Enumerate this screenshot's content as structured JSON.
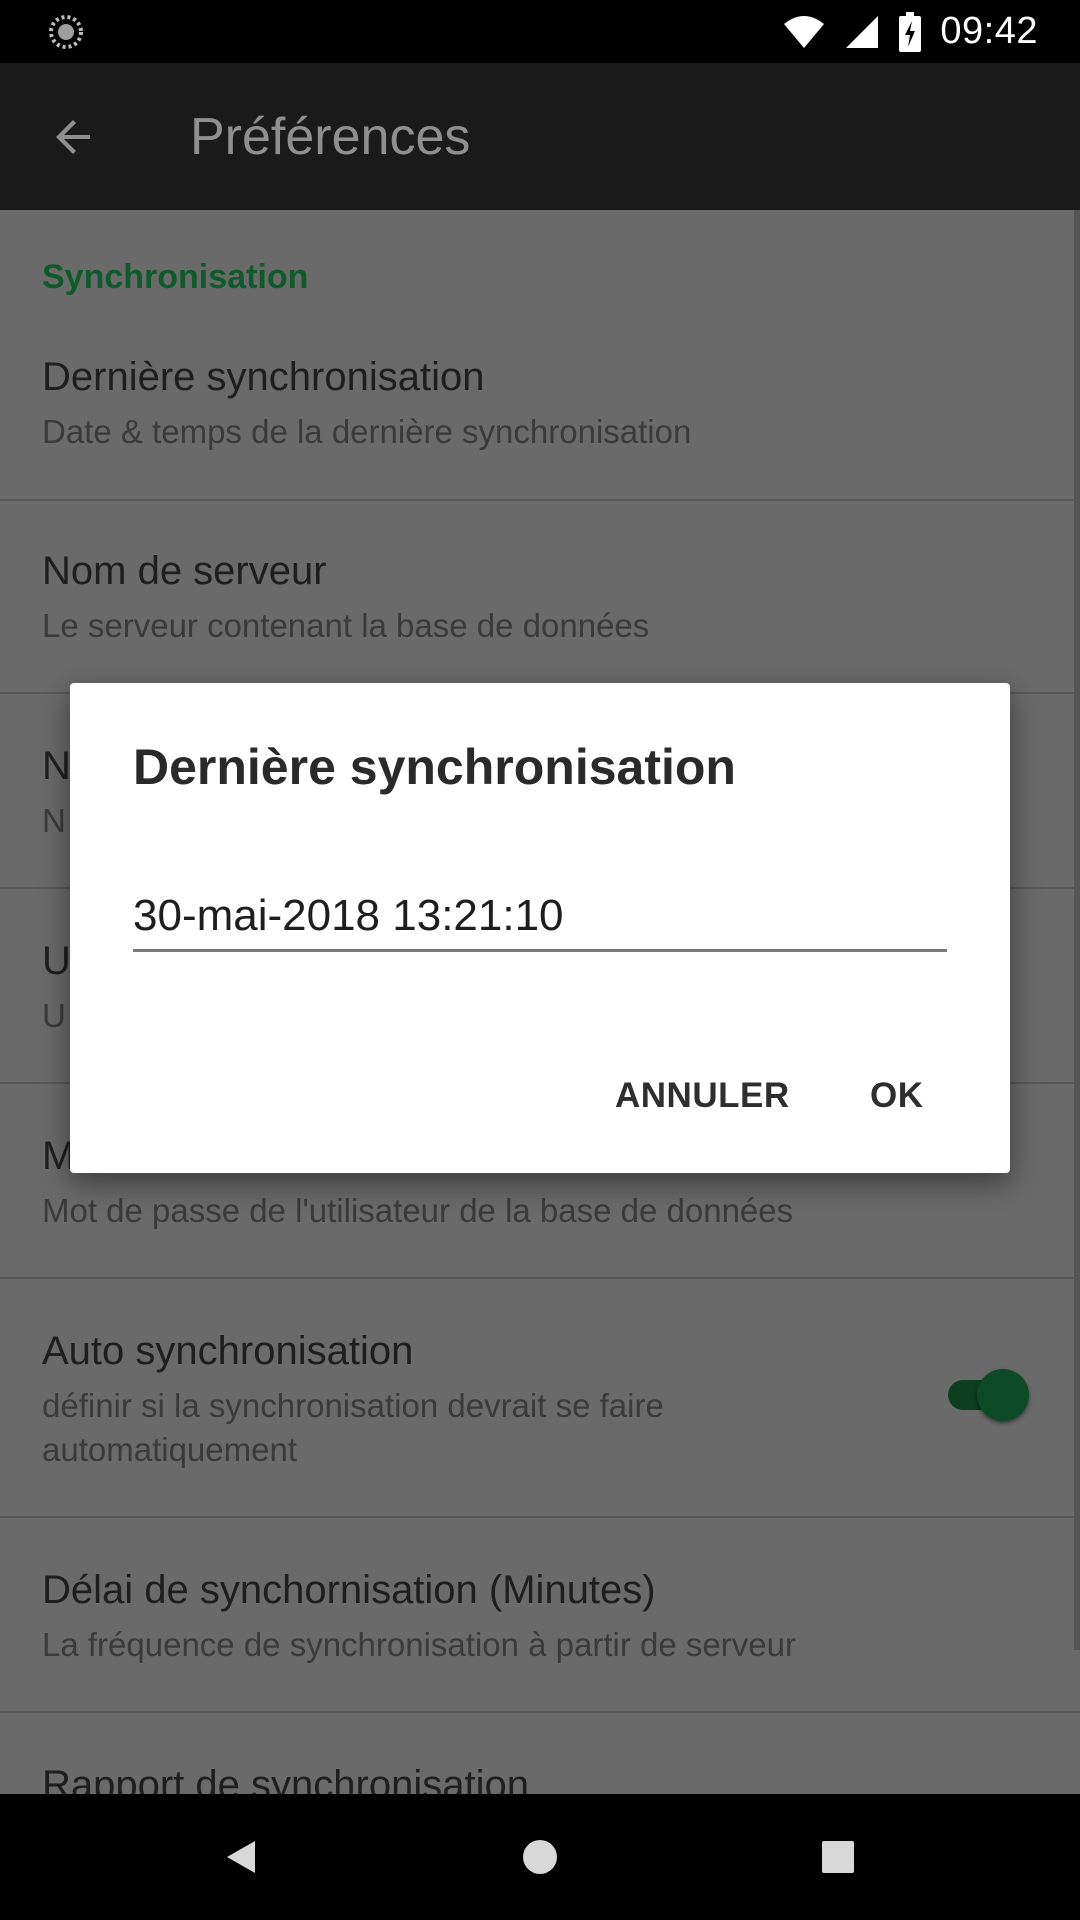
{
  "status_bar": {
    "time": "09:42",
    "icons": [
      "loading-spinner-icon",
      "wifi-icon",
      "signal-icon",
      "battery-charging-icon"
    ]
  },
  "app_bar": {
    "back_icon": "arrow-back-icon",
    "title": "Préférences"
  },
  "preferences": {
    "section_header": "Synchronisation",
    "items": [
      {
        "title": "Dernière synchronisation",
        "summary": "Date & temps de la dernière synchronisation"
      },
      {
        "title": "Nom de serveur",
        "summary": "Le serveur contenant la base de données"
      },
      {
        "title": "N",
        "summary": "N"
      },
      {
        "title": "U",
        "summary": "U"
      },
      {
        "title": "M",
        "summary": "Mot de passe de l'utilisateur de la base de données"
      },
      {
        "title": "Auto synchronisation",
        "summary_line1": "définir si la synchronisation devrait se faire",
        "summary_line2": "automatiquement",
        "toggle_on": true
      },
      {
        "title": "Délai de synchornisation (Minutes)",
        "summary": "La fréquence de synchronisation à partir de serveur"
      },
      {
        "title": "Rapport de synchronisation"
      }
    ]
  },
  "dialog": {
    "title": "Dernière synchronisation",
    "input_value": "30-mai-2018 13:21:10",
    "cancel_label": "ANNULER",
    "ok_label": "OK"
  },
  "nav_bar": {
    "icons": [
      "back-triangle-icon",
      "home-circle-icon",
      "recents-square-icon"
    ]
  },
  "colors": {
    "accent": "#0f5a2b",
    "toggle": "#0b4a24",
    "scrim_background": "#6a6a6a"
  }
}
